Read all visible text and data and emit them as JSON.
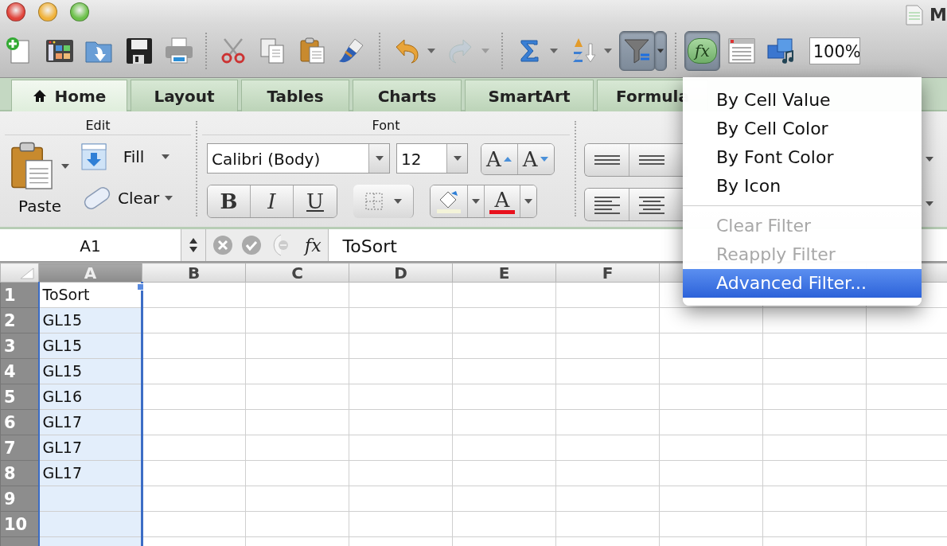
{
  "window": {
    "title": "M"
  },
  "toolbar": {
    "items": [
      {
        "kind": "new",
        "pressed": false,
        "disabled": false,
        "dropdown": false
      },
      {
        "kind": "gallery",
        "pressed": false,
        "disabled": false,
        "dropdown": false
      },
      {
        "kind": "open",
        "pressed": false,
        "disabled": false,
        "dropdown": false
      },
      {
        "kind": "save",
        "pressed": false,
        "disabled": false,
        "dropdown": false
      },
      {
        "kind": "print",
        "pressed": false,
        "disabled": false,
        "dropdown": false
      },
      {
        "kind": "separator"
      },
      {
        "kind": "cut",
        "pressed": false,
        "disabled": false,
        "dropdown": false
      },
      {
        "kind": "copy",
        "pressed": false,
        "disabled": false,
        "dropdown": false
      },
      {
        "kind": "paste",
        "pressed": false,
        "disabled": false,
        "dropdown": false
      },
      {
        "kind": "format-painter",
        "pressed": false,
        "disabled": false,
        "dropdown": false
      },
      {
        "kind": "separator"
      },
      {
        "kind": "undo",
        "pressed": false,
        "disabled": false,
        "dropdown": true
      },
      {
        "kind": "redo",
        "pressed": false,
        "disabled": true,
        "dropdown": true
      },
      {
        "kind": "separator"
      },
      {
        "kind": "sum",
        "pressed": false,
        "disabled": false,
        "dropdown": true
      },
      {
        "kind": "sort",
        "pressed": false,
        "disabled": false,
        "dropdown": true
      },
      {
        "kind": "filter",
        "pressed": true,
        "disabled": false,
        "dropdown": false
      },
      {
        "kind": "filter-dropdown",
        "pressed": true,
        "disabled": false,
        "dropdown": true
      },
      {
        "kind": "separator"
      },
      {
        "kind": "formula-builder",
        "pressed": true,
        "disabled": false,
        "dropdown": false,
        "label": "fx"
      },
      {
        "kind": "toolbox",
        "pressed": false,
        "disabled": false,
        "dropdown": false
      },
      {
        "kind": "media",
        "pressed": false,
        "disabled": false,
        "dropdown": false
      }
    ],
    "zoom": "100%"
  },
  "ribbon_tabs": [
    {
      "label": "Home",
      "selected": true,
      "icon": true
    },
    {
      "label": "Layout",
      "selected": false,
      "icon": false
    },
    {
      "label": "Tables",
      "selected": false,
      "icon": false
    },
    {
      "label": "Charts",
      "selected": false,
      "icon": false
    },
    {
      "label": "SmartArt",
      "selected": false,
      "icon": false
    },
    {
      "label": "Formula",
      "selected": false,
      "icon": false
    }
  ],
  "edit_group": {
    "title": "Edit",
    "paste": "Paste",
    "fill": "Fill",
    "clear": "Clear"
  },
  "font_group": {
    "title": "Font",
    "font_name": "Calibri (Body)",
    "font_size": "12",
    "grow": "A",
    "shrink": "A",
    "bold": "B",
    "italic": "I",
    "underline": "U",
    "font_color_glyph": "A"
  },
  "formula_bar": {
    "name_box": "A1",
    "fx": "fx",
    "content": "ToSort"
  },
  "sheet": {
    "columns": [
      {
        "label": "A",
        "selected": true
      },
      {
        "label": "B",
        "selected": false
      },
      {
        "label": "C",
        "selected": false
      },
      {
        "label": "D",
        "selected": false
      },
      {
        "label": "E",
        "selected": false
      },
      {
        "label": "F",
        "selected": false
      }
    ],
    "rows": [
      {
        "number": "1",
        "cells": [
          {
            "text": "ToSort",
            "active": true
          }
        ]
      },
      {
        "number": "2",
        "cells": [
          {
            "text": "GL15",
            "active": false
          }
        ]
      },
      {
        "number": "3",
        "cells": [
          {
            "text": "GL15",
            "active": false
          }
        ]
      },
      {
        "number": "4",
        "cells": [
          {
            "text": "GL15",
            "active": false
          }
        ]
      },
      {
        "number": "5",
        "cells": [
          {
            "text": "GL16",
            "active": false
          }
        ]
      },
      {
        "number": "6",
        "cells": [
          {
            "text": "GL17",
            "active": false
          }
        ]
      },
      {
        "number": "7",
        "cells": [
          {
            "text": "GL17",
            "active": false
          }
        ]
      },
      {
        "number": "8",
        "cells": [
          {
            "text": "GL17",
            "active": false
          }
        ]
      },
      {
        "number": "9",
        "cells": [
          {
            "active": false
          }
        ]
      },
      {
        "number": "10",
        "cells": [
          {
            "active": false
          }
        ]
      }
    ]
  },
  "filter_menu": {
    "items": [
      {
        "kind": "item",
        "label": "By Cell Value",
        "disabled": false,
        "selected": false
      },
      {
        "kind": "item",
        "label": "By Cell Color",
        "disabled": false,
        "selected": false
      },
      {
        "kind": "item",
        "label": "By Font Color",
        "disabled": false,
        "selected": false
      },
      {
        "kind": "item",
        "label": "By Icon",
        "disabled": false,
        "selected": false
      },
      {
        "kind": "separator"
      },
      {
        "kind": "item",
        "label": "Clear Filter",
        "disabled": true,
        "selected": false
      },
      {
        "kind": "item",
        "label": "Reapply Filter",
        "disabled": true,
        "selected": false
      },
      {
        "kind": "item",
        "label": "Advanced Filter...",
        "disabled": false,
        "selected": true
      }
    ]
  }
}
